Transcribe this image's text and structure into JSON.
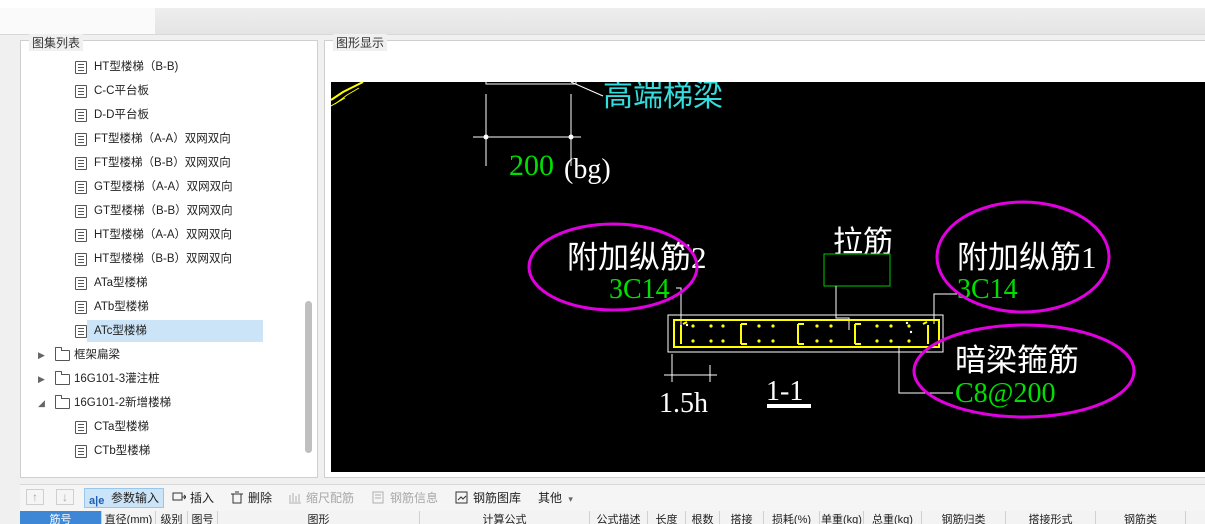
{
  "left_panel": {
    "title": "图集列表",
    "items": [
      {
        "label": "HT型楼梯（B-B)",
        "kind": "file"
      },
      {
        "label": "C-C平台板",
        "kind": "file"
      },
      {
        "label": "D-D平台板",
        "kind": "file"
      },
      {
        "label": "FT型楼梯（A-A）双网双向",
        "kind": "file"
      },
      {
        "label": "FT型楼梯（B-B）双网双向",
        "kind": "file"
      },
      {
        "label": "GT型楼梯（A-A）双网双向",
        "kind": "file"
      },
      {
        "label": "GT型楼梯（B-B）双网双向",
        "kind": "file"
      },
      {
        "label": "HT型楼梯（A-A）双网双向",
        "kind": "file"
      },
      {
        "label": "HT型楼梯（B-B）双网双向",
        "kind": "file"
      },
      {
        "label": "ATa型楼梯",
        "kind": "file"
      },
      {
        "label": "ATb型楼梯",
        "kind": "file"
      },
      {
        "label": "ATc型楼梯",
        "kind": "file",
        "selected": true
      },
      {
        "label": "框架扁梁",
        "kind": "folder",
        "expanded": false
      },
      {
        "label": "16G101-3灌注桩",
        "kind": "folder",
        "expanded": false
      },
      {
        "label": "16G101-2新增楼梯",
        "kind": "folder",
        "expanded": true
      },
      {
        "label": "CTa型楼梯",
        "kind": "file"
      },
      {
        "label": "CTb型楼梯",
        "kind": "file"
      }
    ]
  },
  "right_panel": {
    "title": "图形显示"
  },
  "drawing": {
    "high_beam_label": "高端梯梁",
    "dim_200": "200",
    "dim_bg": "(bg)",
    "tie_bar_label": "拉筋",
    "extra_long_bar_2_label": "附加纵筋2",
    "extra_long_bar_2_value": "3C14",
    "extra_long_bar_1_label": "附加纵筋1",
    "extra_long_bar_1_value": "3C14",
    "hidden_beam_stirrup_label": "暗梁箍筋",
    "hidden_beam_stirrup_value": "C8@200",
    "dim_15h": "1.5h",
    "section_label": "1-1",
    "colors": {
      "background": "#000000",
      "text_white": "#ffffff",
      "text_green": "#00e000",
      "text_cyan": "#33dddd",
      "rebar_yellow": "#ffff00",
      "marker_magenta": "#e000e0"
    }
  },
  "toolbar": {
    "up_label": "↑",
    "down_label": "↓",
    "param_input": "参数输入",
    "insert": "插入",
    "delete": "删除",
    "scale_rebar": "缩尺配筋",
    "rebar_info": "钢筋信息",
    "rebar_library": "钢筋图库",
    "other": "其他",
    "other_arrow": "▾"
  },
  "table_header": {
    "columns": [
      "筋号",
      "直径(mm)",
      "级别",
      "图号",
      "图形",
      "计算公式",
      "公式描述",
      "长度",
      "根数",
      "搭接",
      "损耗(%)",
      "单重(kg)",
      "总重(kg)",
      "钢筋归类",
      "搭接形式",
      "钢筋类"
    ]
  }
}
